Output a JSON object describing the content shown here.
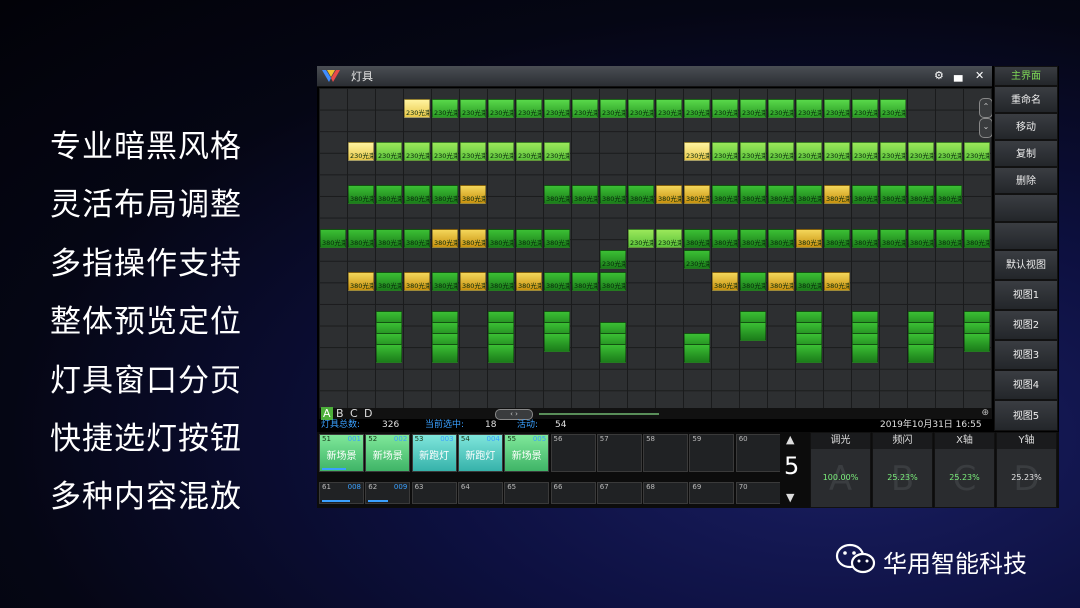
{
  "features": [
    "专业暗黑风格",
    "灵活布局调整",
    "多指操作支持",
    "整体预览定位",
    "灯具窗口分页",
    "快捷选灯按钮",
    "多种内容混放"
  ],
  "window": {
    "title": "灯具"
  },
  "fixtures": [
    [
      {
        "c": "y2",
        "l": "230光束"
      },
      null,
      null,
      null,
      null,
      null,
      null,
      null,
      null,
      null,
      null,
      null,
      null,
      null,
      null,
      null,
      null,
      null,
      null,
      null,
      null,
      null,
      null,
      null
    ],
    [
      {
        "c": "g1",
        "l": "230光束"
      },
      {
        "c": "g1",
        "l": "230光束"
      },
      {
        "c": "g1",
        "l": "230光束"
      },
      {
        "c": "g1",
        "l": "230光束"
      },
      {
        "c": "g1",
        "l": "230光束"
      },
      {
        "c": "g1",
        "l": "230光束"
      },
      {
        "c": "g1",
        "l": "230光束"
      },
      {
        "c": "g1",
        "l": "230光束"
      },
      {
        "c": "g1",
        "l": "230光束"
      },
      {
        "c": "g1",
        "l": "230光束"
      },
      {
        "c": "g1",
        "l": "230光束"
      },
      {
        "c": "g1",
        "l": "230光束"
      },
      {
        "c": "g1",
        "l": "230光束"
      },
      {
        "c": "g1",
        "l": "230光束"
      },
      {
        "c": "g1",
        "l": "230光束"
      },
      {
        "c": "g1",
        "l": "230光束"
      },
      {
        "c": "g1",
        "l": "230光束"
      }
    ],
    [
      {
        "c": "y2",
        "l": "230光束"
      },
      {
        "c": "g3",
        "l": "230光束"
      },
      {
        "c": "g3",
        "l": "230光束"
      },
      {
        "c": "g3",
        "l": "230光束"
      },
      {
        "c": "g3",
        "l": "230光束"
      },
      {
        "c": "g3",
        "l": "230光束"
      },
      {
        "c": "g3",
        "l": "230光束"
      },
      {
        "c": "g3",
        "l": "230光束"
      },
      {
        "c": "y2",
        "l": "230光束"
      },
      {
        "c": "g3",
        "l": "230光束"
      },
      {
        "c": "g3",
        "l": "230光束"
      },
      {
        "c": "g3",
        "l": "230光束"
      },
      {
        "c": "g3",
        "l": "230光束"
      },
      {
        "c": "g3",
        "l": "230光束"
      },
      {
        "c": "g3",
        "l": "230光束"
      },
      {
        "c": "g3",
        "l": "230光束"
      },
      {
        "c": "g3",
        "l": "230光束"
      },
      {
        "c": "g3",
        "l": "230光束"
      },
      {
        "c": "g3",
        "l": "230光束"
      },
      {
        "c": "g3",
        "l": "230光束"
      }
    ],
    [
      {
        "c": "g2",
        "l": "380光束"
      },
      {
        "c": "g2",
        "l": "380光束"
      },
      {
        "c": "g2",
        "l": "380光束"
      },
      {
        "c": "g2",
        "l": "380光束"
      },
      {
        "c": "y1",
        "l": "380光束"
      },
      {
        "c": "g2",
        "l": "380光束"
      },
      {
        "c": "g2",
        "l": "380光束"
      },
      {
        "c": "g2",
        "l": "380光束"
      },
      {
        "c": "g2",
        "l": "380光束"
      },
      {
        "c": "y1",
        "l": "380光束"
      },
      {
        "c": "y1",
        "l": "380光束"
      },
      {
        "c": "g2",
        "l": "380光束"
      },
      {
        "c": "g2",
        "l": "380光束"
      },
      {
        "c": "g2",
        "l": "380光束"
      },
      {
        "c": "g2",
        "l": "380光束"
      },
      {
        "c": "y1",
        "l": "380光束"
      },
      {
        "c": "g2",
        "l": "380光束"
      },
      {
        "c": "g2",
        "l": "380光束"
      },
      {
        "c": "g2",
        "l": "380光束"
      },
      {
        "c": "g2",
        "l": "380光束"
      }
    ],
    [
      {
        "c": "g2",
        "l": "380光束"
      },
      {
        "c": "g2",
        "l": "380光束"
      },
      {
        "c": "g2",
        "l": "380光束"
      },
      {
        "c": "g2",
        "l": "380光束"
      },
      {
        "c": "y1",
        "l": "380光束"
      },
      {
        "c": "y1",
        "l": "380光束"
      },
      {
        "c": "g2",
        "l": "380光束"
      },
      {
        "c": "g2",
        "l": "380光束"
      },
      {
        "c": "g2",
        "l": "380光束"
      },
      {
        "c": "g3",
        "l": "230光束"
      },
      {
        "c": "g3",
        "l": "230光束"
      },
      {
        "c": "g2",
        "l": "380光束"
      },
      {
        "c": "g2",
        "l": "380光束"
      },
      {
        "c": "g2",
        "l": "380光束"
      },
      {
        "c": "g2",
        "l": "380光束"
      },
      {
        "c": "y1",
        "l": "380光束"
      },
      {
        "c": "g2",
        "l": "380光束"
      },
      {
        "c": "g2",
        "l": "380光束"
      },
      {
        "c": "g2",
        "l": "380光束"
      },
      {
        "c": "g2",
        "l": "380光束"
      },
      {
        "c": "g2",
        "l": "380光束"
      },
      {
        "c": "g2",
        "l": "380光束"
      },
      {
        "c": "g2",
        "l": "380光束"
      },
      {
        "c": "g2",
        "l": "380光束"
      }
    ],
    [
      {
        "c": "g2",
        "l": "230光束"
      },
      {
        "c": "g2",
        "l": "230光束"
      }
    ],
    [
      {
        "c": "y1",
        "l": "380光束"
      },
      {
        "c": "g2",
        "l": "380光束"
      },
      {
        "c": "y1",
        "l": "380光束"
      },
      {
        "c": "g2",
        "l": "380光束"
      },
      {
        "c": "y1",
        "l": "380光束"
      },
      {
        "c": "g2",
        "l": "380光束"
      },
      {
        "c": "y1",
        "l": "380光束"
      },
      {
        "c": "g2",
        "l": "380光束"
      },
      {
        "c": "g2",
        "l": "380光束"
      },
      {
        "c": "g2",
        "l": "380光束"
      },
      {
        "c": "y1",
        "l": "380光束"
      },
      {
        "c": "g2",
        "l": "380光束"
      },
      {
        "c": "y1",
        "l": "380光束"
      },
      {
        "c": "g2",
        "l": "380光束"
      },
      {
        "c": "y1",
        "l": "380光束"
      }
    ],
    [
      {
        "c": "g2",
        "l": "380光束"
      }
    ]
  ],
  "pages": [
    "A",
    "B",
    "C",
    "D"
  ],
  "status": {
    "total_label": "灯具总数:",
    "total_value": "326",
    "selected_label": "当前选中:",
    "selected_value": "18",
    "active_label": "活动:",
    "active_value": "54",
    "datetime": "2019年10月31日 16:55"
  },
  "sidebar": {
    "main": "主界面",
    "rename": "重命名",
    "move": "移动",
    "copy": "复制",
    "delete": "删除",
    "default_view": "默认视图",
    "views": [
      "视图1",
      "视图2",
      "视图3",
      "视图4",
      "视图5"
    ]
  },
  "cues_row1": [
    {
      "n": "51",
      "id": "001",
      "label": "新场景",
      "style": "on",
      "bar": 0.6
    },
    {
      "n": "52",
      "id": "002",
      "label": "新场景",
      "style": "on",
      "bar": 0.0
    },
    {
      "n": "53",
      "id": "003",
      "label": "新跑灯",
      "style": "on2",
      "bar": 0.0
    },
    {
      "n": "54",
      "id": "004",
      "label": "新跑灯",
      "style": "on2",
      "bar": 0.0
    },
    {
      "n": "55",
      "id": "005",
      "label": "新场景",
      "style": "on",
      "bar": 0.0
    },
    {
      "n": "56",
      "id": "",
      "label": "",
      "style": "",
      "bar": 0
    },
    {
      "n": "57",
      "id": "",
      "label": "",
      "style": "",
      "bar": 0
    },
    {
      "n": "58",
      "id": "",
      "label": "",
      "style": "",
      "bar": 0
    },
    {
      "n": "59",
      "id": "",
      "label": "",
      "style": "",
      "bar": 0
    },
    {
      "n": "60",
      "id": "",
      "label": "",
      "style": "",
      "bar": 0
    }
  ],
  "cues_row2": [
    {
      "n": "61",
      "id": "008",
      "bar": 0.7
    },
    {
      "n": "62",
      "id": "009",
      "bar": 0.5
    },
    {
      "n": "63",
      "id": "",
      "bar": 0
    },
    {
      "n": "64",
      "id": "",
      "bar": 0
    },
    {
      "n": "65",
      "id": "",
      "bar": 0
    },
    {
      "n": "66",
      "id": "",
      "bar": 0
    },
    {
      "n": "67",
      "id": "",
      "bar": 0
    },
    {
      "n": "68",
      "id": "",
      "bar": 0
    },
    {
      "n": "69",
      "id": "",
      "bar": 0
    },
    {
      "n": "70",
      "id": "",
      "bar": 0
    }
  ],
  "cue_page": "5",
  "faders": [
    {
      "name": "调光",
      "letter": "A",
      "value": "100.00%",
      "color": "green"
    },
    {
      "name": "频闪",
      "letter": "B",
      "value": "25.23%",
      "color": "green"
    },
    {
      "name": "X轴",
      "letter": "C",
      "value": "25.23%",
      "color": "green"
    },
    {
      "name": "Y轴",
      "letter": "D",
      "value": "25.23%",
      "color": "white"
    }
  ],
  "brand": {
    "name": "华用智能科技"
  }
}
